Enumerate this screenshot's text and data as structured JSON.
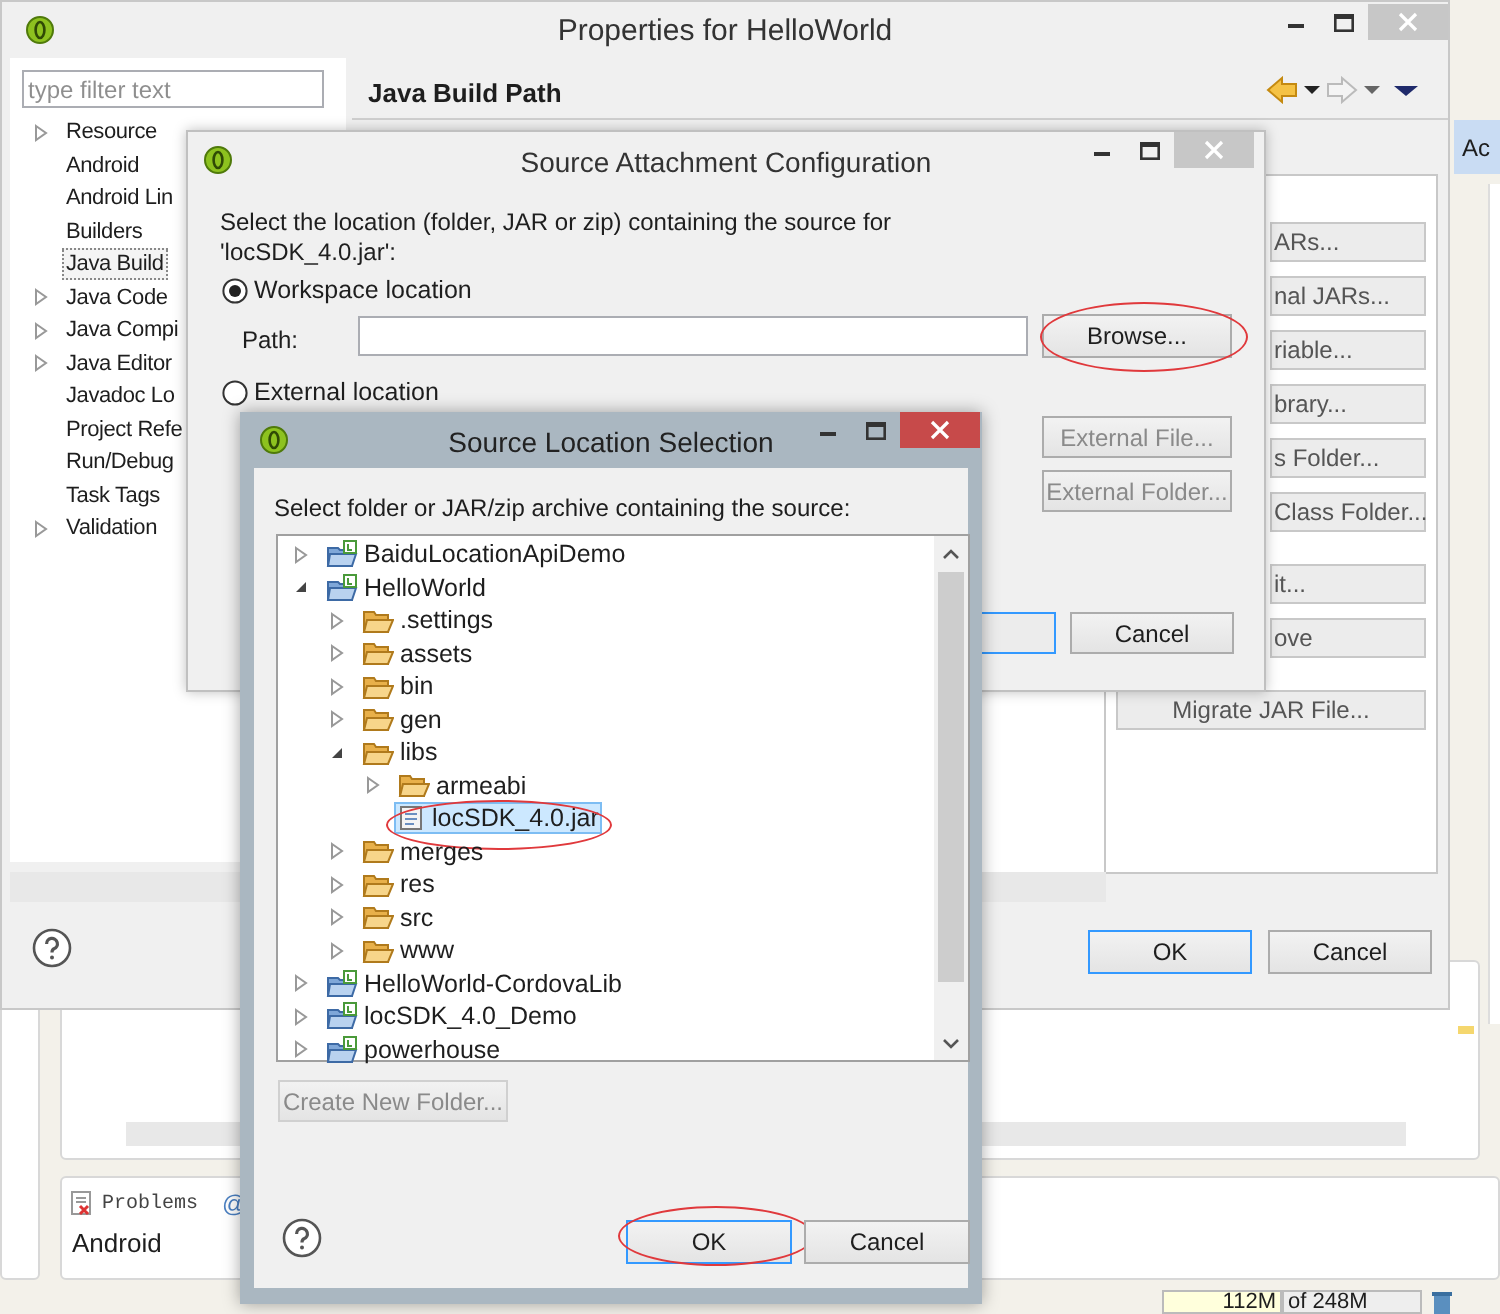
{
  "workbench": {
    "side_tab": "Ac",
    "problems_tab": "Problems",
    "problems_tab_2": "@",
    "problems_row": "Android",
    "memory_used": "112M",
    "memory_total": "of 248M"
  },
  "properties": {
    "title": "Properties for HelloWorld",
    "filter_placeholder": "type filter text",
    "page_title": "Java Build Path",
    "nav": [
      {
        "label": "Resource",
        "expandable": true,
        "selected": false
      },
      {
        "label": "Android",
        "expandable": false,
        "selected": false
      },
      {
        "label": "Android Lin",
        "expandable": false,
        "selected": false
      },
      {
        "label": "Builders",
        "expandable": false,
        "selected": false
      },
      {
        "label": "Java Build",
        "expandable": false,
        "selected": true
      },
      {
        "label": "Java Code",
        "expandable": true,
        "selected": false
      },
      {
        "label": "Java Compi",
        "expandable": true,
        "selected": false
      },
      {
        "label": "Java Editor",
        "expandable": true,
        "selected": false
      },
      {
        "label": "Javadoc Lo",
        "expandable": false,
        "selected": false
      },
      {
        "label": "Project Refe",
        "expandable": false,
        "selected": false
      },
      {
        "label": "Run/Debug",
        "expandable": false,
        "selected": false
      },
      {
        "label": "Task Tags",
        "expandable": false,
        "selected": false
      },
      {
        "label": "Validation",
        "expandable": true,
        "selected": false
      }
    ],
    "side_buttons": [
      {
        "label": "ARs...",
        "cut_off": true,
        "starts_group": false
      },
      {
        "label": "nal JARs...",
        "cut_off": true,
        "starts_group": false
      },
      {
        "label": "riable...",
        "cut_off": true,
        "starts_group": false
      },
      {
        "label": "brary...",
        "cut_off": true,
        "starts_group": false
      },
      {
        "label": "s Folder...",
        "cut_off": true,
        "starts_group": false
      },
      {
        "label": "Class Folder...",
        "cut_off": true,
        "starts_group": false
      },
      {
        "label": "it...",
        "cut_off": true,
        "starts_group": true
      },
      {
        "label": "ove",
        "cut_off": true,
        "starts_group": false
      },
      {
        "label": "Migrate JAR File...",
        "cut_off": false,
        "starts_group": true
      }
    ],
    "buttons": [
      {
        "label": "OK",
        "default": true
      },
      {
        "label": "Cancel",
        "default": false
      }
    ]
  },
  "source_attachment": {
    "title": "Source Attachment Configuration",
    "prompt": "Select the location (folder, JAR or zip) containing the source for\n'locSDK_4.0.jar':",
    "options": [
      {
        "label": "Workspace location",
        "selected": true
      },
      {
        "label": "External location",
        "selected": false
      }
    ],
    "path_label": "Path:",
    "browse": {
      "label": "Browse...",
      "circled": true
    },
    "external_buttons": [
      {
        "label": "External File...",
        "disabled": true
      },
      {
        "label": "External Folder...",
        "disabled": true
      }
    ],
    "cancel": "Cancel"
  },
  "source_selection": {
    "title": "Source Location Selection",
    "prompt": "Select folder or JAR/zip archive containing the source:",
    "tree": [
      {
        "label": "BaiduLocationApiDemo",
        "kind": "project",
        "expanded": false,
        "selected": false,
        "circled": false
      },
      {
        "label": "HelloWorld",
        "kind": "project",
        "expanded": true,
        "selected": false,
        "circled": false,
        "children": [
          {
            "label": ".settings",
            "kind": "folder",
            "expanded": false,
            "selected": false,
            "circled": false
          },
          {
            "label": "assets",
            "kind": "folder",
            "expanded": false,
            "selected": false,
            "circled": false
          },
          {
            "label": "bin",
            "kind": "folder",
            "expanded": false,
            "selected": false,
            "circled": false
          },
          {
            "label": "gen",
            "kind": "folder",
            "expanded": false,
            "selected": false,
            "circled": false
          },
          {
            "label": "libs",
            "kind": "folder",
            "expanded": true,
            "selected": false,
            "circled": false,
            "children": [
              {
                "label": "armeabi",
                "kind": "folder",
                "expanded": false,
                "selected": false,
                "circled": false
              },
              {
                "label": "locSDK_4.0.jar",
                "kind": "jar",
                "selected": true,
                "circled": true
              }
            ]
          },
          {
            "label": "merges",
            "kind": "folder",
            "expanded": false,
            "selected": false,
            "circled": false
          },
          {
            "label": "res",
            "kind": "folder",
            "expanded": false,
            "selected": false,
            "circled": false
          },
          {
            "label": "src",
            "kind": "folder",
            "expanded": false,
            "selected": false,
            "circled": false
          },
          {
            "label": "www",
            "kind": "folder",
            "expanded": false,
            "selected": false,
            "circled": false
          }
        ]
      },
      {
        "label": "HelloWorld-CordovaLib",
        "kind": "project",
        "expanded": false,
        "selected": false,
        "circled": false
      },
      {
        "label": "locSDK_4.0_Demo",
        "kind": "project",
        "expanded": false,
        "selected": false,
        "circled": false
      },
      {
        "label": "powerhouse",
        "kind": "project",
        "expanded": false,
        "selected": false,
        "circled": false
      }
    ],
    "create_folder": {
      "label": "Create New Folder...",
      "disabled": true
    },
    "buttons": [
      {
        "label": "OK",
        "default": true,
        "circled": true
      },
      {
        "label": "Cancel",
        "default": false,
        "circled": false
      }
    ]
  }
}
